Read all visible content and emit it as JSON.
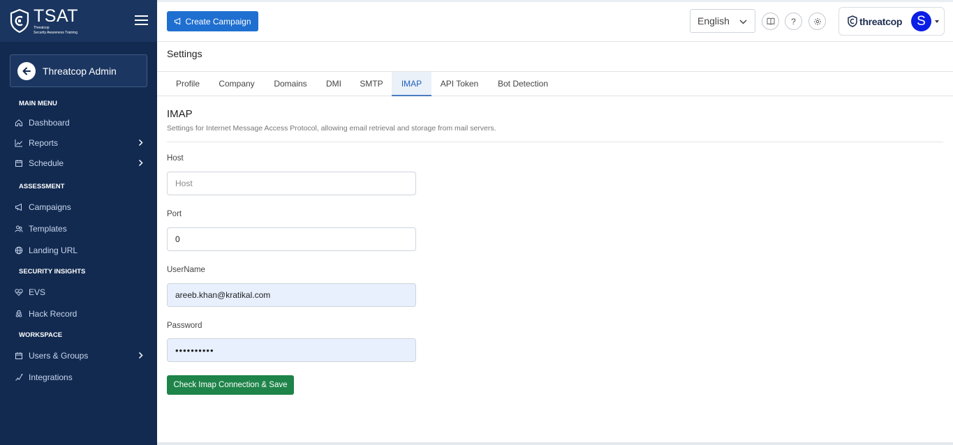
{
  "brand": {
    "title": "TSAT",
    "subtitle_line1": "Threatcop",
    "subtitle_line2": "Security Awareness Training"
  },
  "sidebar": {
    "admin_label": "Threatcop Admin",
    "sections": [
      {
        "title": "MAIN MENU",
        "items": [
          {
            "label": "Dashboard",
            "icon": "home-icon",
            "chevron": false
          },
          {
            "label": "Reports",
            "icon": "chart-line-icon",
            "chevron": true
          },
          {
            "label": "Schedule",
            "icon": "calendar-icon",
            "chevron": true
          }
        ]
      },
      {
        "title": "ASSESSMENT",
        "items": [
          {
            "label": "Campaigns",
            "icon": "megaphone-icon",
            "chevron": false
          },
          {
            "label": "Templates",
            "icon": "users-icon",
            "chevron": false
          },
          {
            "label": "Landing URL",
            "icon": "globe-icon",
            "chevron": false
          }
        ]
      },
      {
        "title": "SECURITY INSIGHTS",
        "items": [
          {
            "label": "EVS",
            "icon": "heart-pulse-icon",
            "chevron": false
          },
          {
            "label": "Hack Record",
            "icon": "spy-icon",
            "chevron": false
          }
        ]
      },
      {
        "title": "WORKSPACE",
        "items": [
          {
            "label": "Users & Groups",
            "icon": "calendar-icon",
            "chevron": true
          },
          {
            "label": "Integrations",
            "icon": "integration-icon",
            "chevron": false
          }
        ]
      }
    ]
  },
  "topbar": {
    "create_campaign": "Create Campaign",
    "language": "English",
    "help_label": "?",
    "brand_name": "threatcop",
    "avatar_letter": "S"
  },
  "page": {
    "title": "Settings",
    "tabs": [
      {
        "label": "Profile",
        "active": false
      },
      {
        "label": "Company",
        "active": false
      },
      {
        "label": "Domains",
        "active": false
      },
      {
        "label": "DMI",
        "active": false
      },
      {
        "label": "SMTP",
        "active": false
      },
      {
        "label": "IMAP",
        "active": true
      },
      {
        "label": "API Token",
        "active": false
      },
      {
        "label": "Bot Detection",
        "active": false
      }
    ],
    "section_title": "IMAP",
    "section_desc": "Settings for Internet Message Access Protocol, allowing email retrieval and storage from mail servers."
  },
  "form": {
    "host_label": "Host",
    "host_placeholder": "Host",
    "host_value": "",
    "port_label": "Port",
    "port_value": "0",
    "username_label": "UserName",
    "username_value": "areeb.khan@kratikal.com",
    "password_label": "Password",
    "password_value": "••••••••••",
    "save_label": "Check Imap Connection & Save"
  },
  "colors": {
    "sidebar_bg": "#122a50",
    "primary": "#1f6fd0",
    "success": "#1e8449",
    "avatar": "#0a1ee6"
  }
}
